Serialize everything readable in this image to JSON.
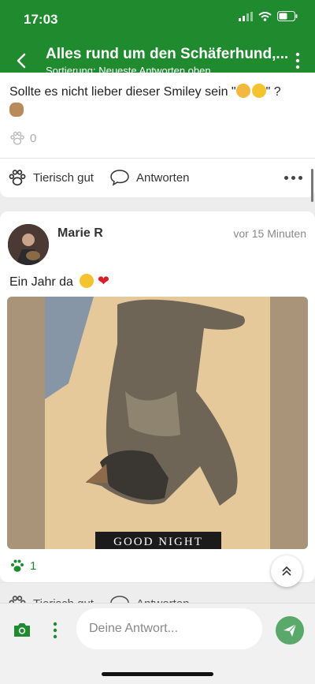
{
  "status_bar": {
    "time": "17:03"
  },
  "header": {
    "title": "Alles rund um den Schäferhund,...",
    "subtitle": "Sortierung: Neueste Antworten oben"
  },
  "post1": {
    "text_before": "Sollte es nicht lieber dieser Smiley sein \"",
    "text_after": "\" ?",
    "paw_count": "0",
    "action_like": "Tierisch gut",
    "action_reply": "Antworten"
  },
  "post2": {
    "author": "Marie R",
    "time_ago": "vor 15 Minuten",
    "text": "Ein Jahr da",
    "photo_caption": "GOOD NIGHT",
    "paw_count": "1"
  },
  "next_actions": {
    "like": "Tierisch gut",
    "reply": "Antworten"
  },
  "reply_bar": {
    "placeholder": "Deine Antwort..."
  },
  "colors": {
    "brand": "#1f8a2e",
    "send": "#5aa96a"
  }
}
